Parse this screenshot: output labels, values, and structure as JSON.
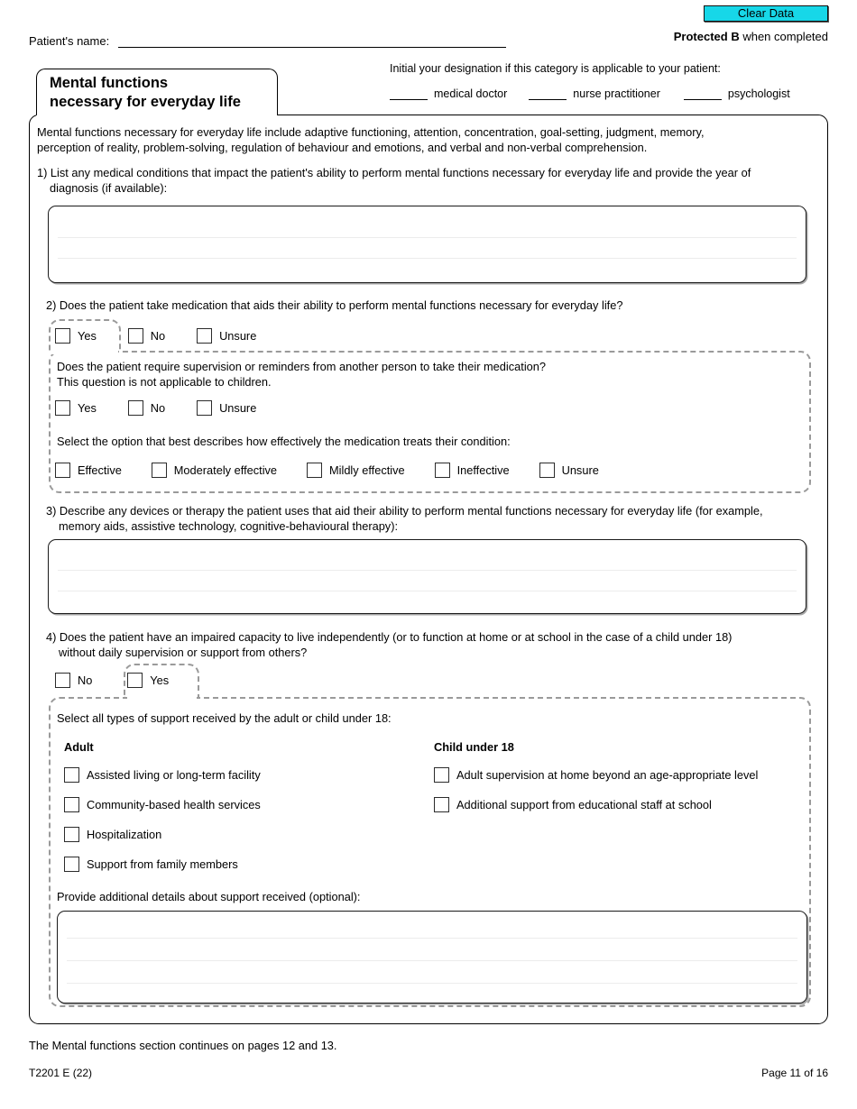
{
  "header": {
    "clear_data_label": "Clear Data",
    "protected_strong": "Protected B",
    "protected_rest": " when completed",
    "patient_name_label": "Patient's name:",
    "designation_title": "Initial your designation if this category is applicable to your patient:",
    "designations": [
      {
        "label": "medical doctor"
      },
      {
        "label": "nurse practitioner"
      },
      {
        "label": "psychologist"
      }
    ]
  },
  "section": {
    "title_line1": "Mental functions",
    "title_line2": "necessary for everyday life",
    "intro_line1": "Mental functions necessary for everyday life include adaptive functioning, attention, concentration, goal-setting, judgment, memory,",
    "intro_line2": "perception of reality, problem-solving, regulation of behaviour and emotions, and verbal and non-verbal comprehension."
  },
  "q1": {
    "line1": "1) List any medical conditions that impact the patient's ability to perform mental functions necessary for everyday life and provide the year of",
    "line2": "diagnosis (if available):"
  },
  "q2": {
    "text": "2) Does the patient take medication that aids their ability to perform mental functions necessary for everyday life?",
    "options": [
      {
        "label": "Yes"
      },
      {
        "label": "No"
      },
      {
        "label": "Unsure"
      }
    ],
    "supervision_line1": "Does the patient require supervision or reminders from another person to take their medication?",
    "supervision_line2": "This question is not applicable to children.",
    "supervision_options": [
      {
        "label": "Yes"
      },
      {
        "label": "No"
      },
      {
        "label": "Unsure"
      }
    ],
    "effectiveness_prompt": "Select the option that best describes how effectively the medication treats their condition:",
    "effectiveness_options": [
      {
        "label": "Effective"
      },
      {
        "label": "Moderately effective"
      },
      {
        "label": "Mildly effective"
      },
      {
        "label": "Ineffective"
      },
      {
        "label": "Unsure"
      }
    ]
  },
  "q3": {
    "line1": "3) Describe any devices or therapy the patient uses that aid their ability to perform mental functions necessary for everyday life (for example,",
    "line2": "memory aids, assistive technology, cognitive-behavioural therapy):"
  },
  "q4": {
    "line1": "4) Does the patient have an impaired capacity to live independently (or to function at home or at school in the case of a child under 18)",
    "line2": "without daily supervision or support from others?",
    "options": [
      {
        "label": "No"
      },
      {
        "label": "Yes"
      }
    ],
    "support_prompt": "Select all types of support received by the adult or child under 18:",
    "adult_heading": "Adult",
    "child_heading": "Child under 18",
    "adult_options": [
      {
        "label": "Assisted living or long-term facility"
      },
      {
        "label": "Community-based health services"
      },
      {
        "label": "Hospitalization"
      },
      {
        "label": "Support from family members"
      }
    ],
    "child_options": [
      {
        "label": "Adult supervision at home beyond an age-appropriate level"
      },
      {
        "label": "Additional support from educational staff at school"
      }
    ],
    "details_prompt": "Provide additional details about support received (optional):"
  },
  "footer": {
    "note": "The Mental functions section continues on pages 12 and 13.",
    "form_code": "T2201 E (22)",
    "page_number": "Page 11 of 16"
  },
  "colors": {
    "clear_data_bg": "#17d7e8",
    "dashed_border": "#9a9a9a",
    "text": "#000000"
  }
}
